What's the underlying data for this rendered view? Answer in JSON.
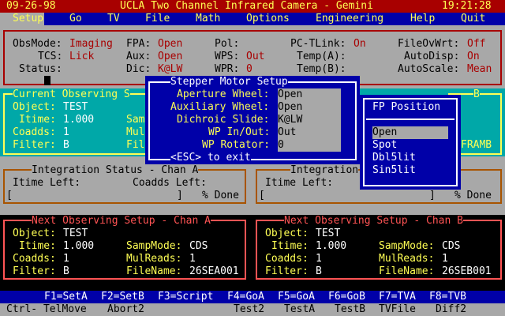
{
  "title": {
    "date": "09-26-98",
    "app": "UCLA Two Channel Infrared Camera - Gemini",
    "time": "19:21:28"
  },
  "menu": [
    "Setup",
    "Go",
    "TV",
    "File",
    "Math",
    "Options",
    "Engineering",
    "Help",
    "Quit"
  ],
  "status": {
    "obsmode_label": "ObsMode:",
    "obsmode_value": "Imaging",
    "tcs_label": "TCS:",
    "tcs_value": "Lick",
    "status_label": "Status:",
    "fpa_label": "FPA:",
    "fpa_value": "Open",
    "aux_label": "Aux:",
    "aux_value": "Open",
    "dic_label": "Dic:",
    "dic_value": "K@LW",
    "pol_label": "Pol:",
    "wps_label": "WPS:",
    "wps_value": "Out",
    "wpr_label": "WPR:",
    "wpr_value": "0",
    "pctlink_label": "PC-TLink:",
    "pctlink_value": "On",
    "tempa_label": "Temp(A):",
    "tempb_label": "Temp(B):",
    "fileovwrt_label": "FileOvWrt:",
    "fileovwrt_value": "Off",
    "autodisp_label": "AutoDisp:",
    "autodisp_value": "On",
    "autoscale_label": "AutoScale:",
    "autoscale_value": "Mean"
  },
  "current_a": {
    "title": "Current Observing S",
    "object_label": "Object:",
    "object_value": "TEST",
    "itime_label": "Itime:",
    "itime_value": "1.000",
    "coadds_label": "Coadds:",
    "coadds_value": "1",
    "filter_label": "Filter:",
    "filter_value": "B",
    "samp_partial": "Sam",
    "mul_partial": "Mul",
    "fil_partial": "Fil"
  },
  "current_b": {
    "title_partial": "B",
    "framb": "FRAMB"
  },
  "stepper": {
    "title": "Stepper Motor Setup",
    "rows": [
      {
        "label": "Aperture Wheel:",
        "value": "Open"
      },
      {
        "label": "Auxiliary Wheel:",
        "value": "Open"
      },
      {
        "label": "Dichroic Slide:",
        "value": "K@LW"
      },
      {
        "label": "WP In/Out:",
        "value": "Out"
      },
      {
        "label": "WP Rotator:",
        "value": "0"
      }
    ],
    "exit": "<ESC> to exit"
  },
  "fp_position": {
    "title": "FP Position",
    "options": [
      "Open",
      "Spot",
      "Dbl5lit",
      "Sin5lit"
    ],
    "selected_index": 0
  },
  "integ_a": {
    "title": "Integration Status - Chan A",
    "itime_left": "Itime Left:",
    "coadds_left": "Coadds Left:",
    "lbr": "[",
    "rbr": "]",
    "pct": "% Done"
  },
  "integ_b": {
    "title": "Integration",
    "itime_left": "Itime Left:",
    "lbr": "[",
    "rbr": "]",
    "pct": "% Done"
  },
  "next_a": {
    "title": "Next Observing Setup - Chan A",
    "object_label": "Object:",
    "object_value": "TEST",
    "itime_label": "Itime:",
    "itime_value": "1.000",
    "coadds_label": "Coadds:",
    "coadds_value": "1",
    "filter_label": "Filter:",
    "filter_value": "B",
    "sampmode_label": "SampMode:",
    "sampmode_value": "CDS",
    "mulreads_label": "MulReads:",
    "mulreads_value": "1",
    "filename_label": "FileName:",
    "filename_value": "26SEA001"
  },
  "next_b": {
    "title": "Next Observing Setup - Chan B",
    "object_label": "Object:",
    "object_value": "TEST",
    "itime_label": "Itime:",
    "itime_value": "1.000",
    "coadds_label": "Coadds:",
    "coadds_value": "1",
    "filter_label": "Filter:",
    "filter_value": "B",
    "sampmode_label": "SampMode:",
    "sampmode_value": "CDS",
    "mulreads_label": "MulReads:",
    "mulreads_value": "1",
    "filename_label": "FileName:",
    "filename_value": "26SEB001"
  },
  "fkeys": [
    "F1=SetA",
    "F2=SetB",
    "F3=Script",
    "F4=GoA",
    "F5=GoA",
    "F6=GoB",
    "F7=TVA",
    "F8=TVB"
  ],
  "ctrl": [
    "Ctrl- TelMove",
    "Abort2",
    "Test2",
    "TestA",
    "TestB",
    "TVFile",
    "Diff2"
  ]
}
